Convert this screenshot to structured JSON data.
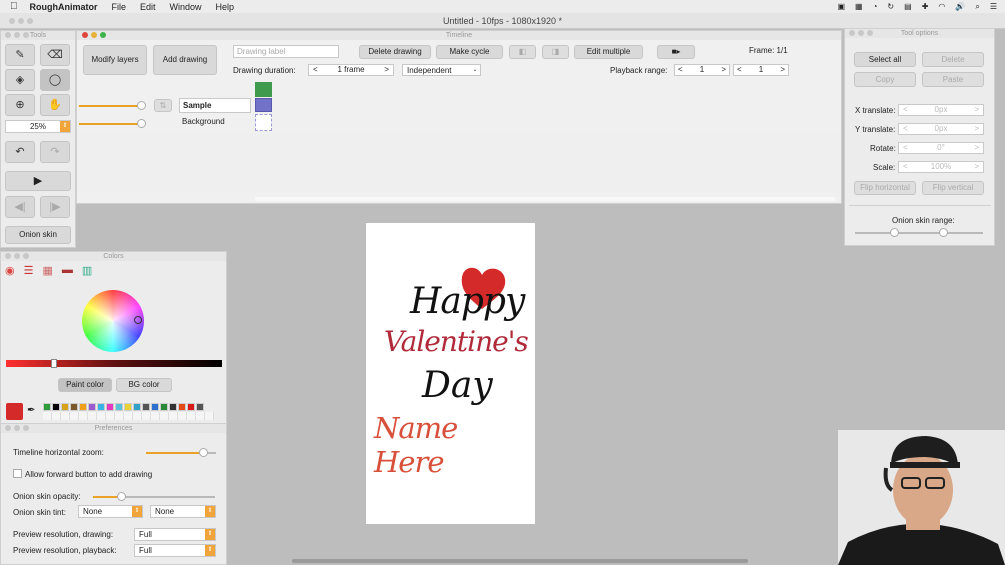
{
  "menubar": {
    "app": "RoughAnimator",
    "items": [
      "File",
      "Edit",
      "Window",
      "Help"
    ]
  },
  "window": {
    "title": "Untitled - 10fps - 1080x1920 *"
  },
  "tools": {
    "title": "Tools",
    "zoom": "25%",
    "onion_label": "Onion skin"
  },
  "timeline": {
    "title": "Timeline",
    "modify_layers": "Modify layers",
    "add_drawing": "Add drawing",
    "drawing_label_placeholder": "Drawing label",
    "delete_drawing": "Delete drawing",
    "make_cycle": "Make cycle",
    "edit_multiple": "Edit multiple",
    "frame": "Frame: 1/1",
    "duration_label": "Drawing duration:",
    "duration_value": "1 frame",
    "independent": "Independent",
    "playback_label": "Playback range:",
    "playback_start": "1",
    "playback_end": "1",
    "layers": [
      "Sample",
      "Background"
    ],
    "layer_colors": [
      "#3f9a4e",
      "#7272c8"
    ]
  },
  "tool_options": {
    "title": "Tool options",
    "select_all": "Select all",
    "delete": "Delete",
    "copy": "Copy",
    "paste": "Paste",
    "x_translate": "X translate:",
    "x_value": "0px",
    "y_translate": "Y translate:",
    "y_value": "0px",
    "rotate": "Rotate:",
    "rotate_value": "0°",
    "scale": "Scale:",
    "scale_value": "100%",
    "flip_h": "Flip horizontal",
    "flip_v": "Flip vertical",
    "onion_range": "Onion skin range:"
  },
  "colors": {
    "title": "Colors",
    "paint_color": "Paint color",
    "bg_color": "BG color",
    "current": "#d42a2a",
    "palette": [
      "#2e9c3c",
      "#000000",
      "#d8a11a",
      "#7a5a2a",
      "#f2a01b",
      "#9a5ad0",
      "#3ab4e8",
      "#e23bbf",
      "#59c2d8",
      "#e8d23a",
      "#33a0c8",
      "#555555",
      "#2f6fd0",
      "#2a8a38",
      "#333333",
      "#e24a1a",
      "#d81a1a",
      "#555555"
    ]
  },
  "preferences": {
    "title": "Preferences",
    "timeline_zoom": "Timeline horizontal zoom:",
    "allow_forward": "Allow forward button to add drawing",
    "onion_opacity": "Onion skin opacity:",
    "onion_tint": "Onion skin tint:",
    "tint_a": "None",
    "tint_b": "None",
    "preview_drawing": "Preview resolution, drawing:",
    "preview_drawing_value": "Full",
    "preview_playback": "Preview resolution, playback:",
    "preview_playback_value": "Full"
  },
  "canvas": {
    "line1": "Happy",
    "line2": "Valentine's",
    "line3": "Day",
    "line4": "Name Here"
  }
}
